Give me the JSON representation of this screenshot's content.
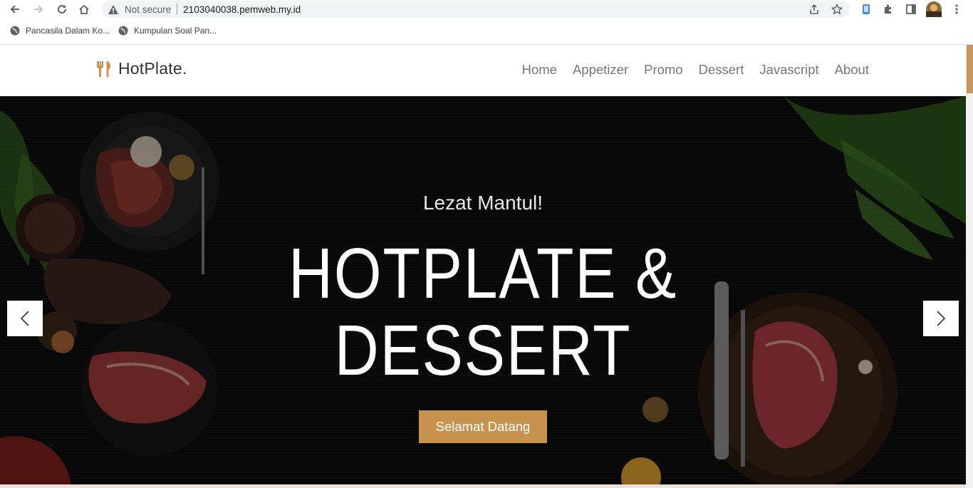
{
  "browser": {
    "security_label": "Not secure",
    "url": "2103040038.pemweb.my.id",
    "bookmarks": [
      {
        "label": "Pancasila Dalam Ko..."
      },
      {
        "label": "Kumpulan Soal Pan..."
      }
    ]
  },
  "site": {
    "brand": "HotPlate.",
    "nav": [
      "Home",
      "Appetizer",
      "Promo",
      "Dessert",
      "Javascript",
      "About"
    ],
    "hero": {
      "subtitle": "Lezat Mantul!",
      "headline_line1": "HOTPLATE &",
      "headline_line2": "DESSERT",
      "cta": "Selamat Datang"
    },
    "colors": {
      "accent": "#c8924f",
      "hero_bg": "#0c0c0c"
    }
  },
  "icons": [
    "back-icon",
    "forward-icon",
    "reload-icon",
    "home-icon",
    "warning-icon",
    "share-icon",
    "star-icon",
    "extension-icon",
    "sidepanel-icon",
    "profile-avatar",
    "menu-icon",
    "globe-icon",
    "fork-knife-icon",
    "chevron-left-icon",
    "chevron-right-icon"
  ]
}
